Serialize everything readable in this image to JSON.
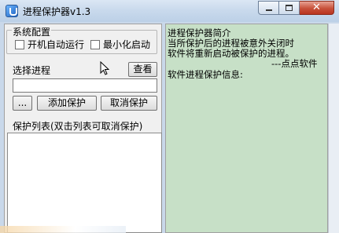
{
  "window": {
    "title": "进程保护器v1.3",
    "buttons": {
      "minimize": "minimize",
      "maximize": "maximize",
      "close": "✕"
    }
  },
  "config": {
    "group_label": "系统配置",
    "autostart_label": "开机自动运行",
    "minimize_start_label": "最小化启动"
  },
  "process": {
    "select_label": "选择进程",
    "view_button": "查看",
    "input_value": "",
    "browse_button": "...",
    "add_button": "添加保护",
    "cancel_button": "取消保护"
  },
  "protect_list": {
    "label": "保护列表(双击列表可取消保护)",
    "items": []
  },
  "info": {
    "line1": "进程保护器简介",
    "line2": "当所保护后的进程被意外关闭时",
    "line3": "软件将重新启动被保护的进程。",
    "line4": "---点点软件",
    "line5": "软件进程保护信息:"
  }
}
